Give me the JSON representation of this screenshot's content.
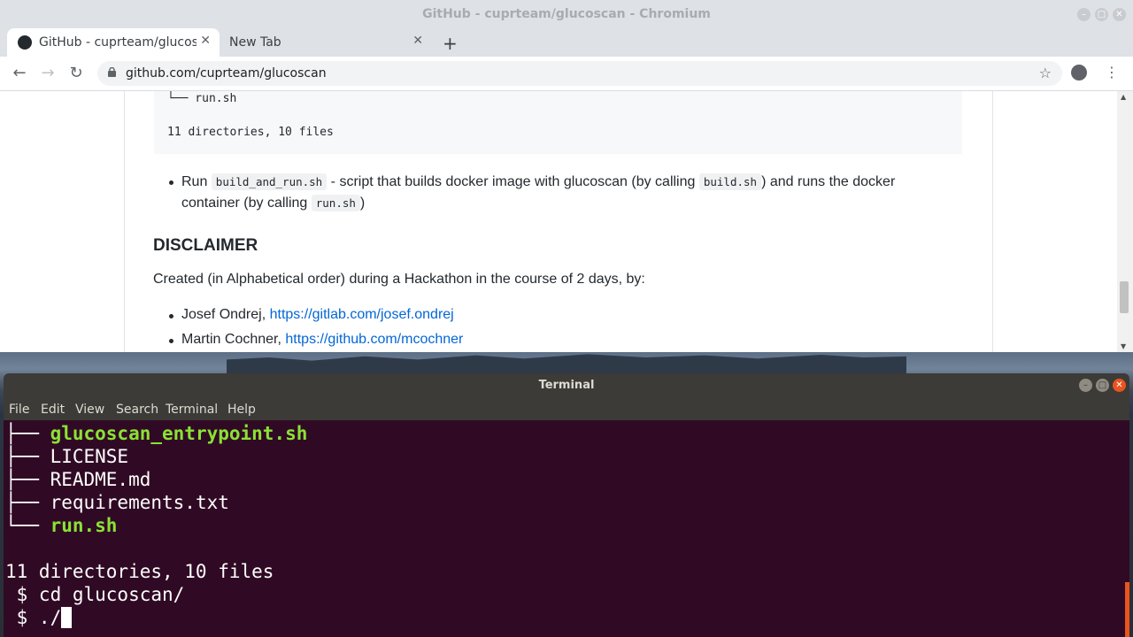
{
  "chromium": {
    "window_title": "GitHub - cuprteam/glucoscan - Chromium",
    "tabs": [
      {
        "label": "GitHub - cuprteam/glucoscan"
      },
      {
        "label": "New Tab"
      }
    ],
    "url": "github.com/cuprteam/glucoscan",
    "icons": [
      "back-icon",
      "forward-icon",
      "reload-icon",
      "lock-icon",
      "star-icon",
      "profile-icon",
      "menu-icon"
    ]
  },
  "readme": {
    "code_tail": "└── run.sh",
    "code_summary": "11 directories, 10 files",
    "run_bullet": {
      "pre": "Run ",
      "code1": "build_and_run.sh",
      "mid": " - script that builds docker image with glucoscan (by calling ",
      "code2": "build.sh",
      "mid2": ") and runs the docker container (by calling ",
      "code3": "run.sh",
      "post": ")"
    },
    "disclaimer_heading": "DISCLAIMER",
    "disclaimer_text": "Created (in Alphabetical order) during a Hackathon in the course of 2 days, by:",
    "authors": [
      {
        "name": "Josef Ondrej, ",
        "link": "https://gitlab.com/josef.ondrej"
      },
      {
        "name": "Martin Cochner, ",
        "link": "https://github.com/mcochner"
      }
    ]
  },
  "terminal": {
    "title": "Terminal",
    "menu": [
      "File",
      "Edit",
      "View",
      "Search",
      "Terminal",
      "Help"
    ],
    "lines": [
      {
        "prefix": "├── ",
        "text": "glucoscan_entrypoint.sh",
        "green": true
      },
      {
        "prefix": "├── ",
        "text": "LICENSE",
        "green": false
      },
      {
        "prefix": "├── ",
        "text": "README.md",
        "green": false
      },
      {
        "prefix": "├── ",
        "text": "requirements.txt",
        "green": false
      },
      {
        "prefix": "└── ",
        "text": "run.sh",
        "green": true
      }
    ],
    "summary": "11 directories, 10 files",
    "cmd1": " $ cd glucoscan/",
    "cmd2": " $ ./"
  },
  "colors": {
    "terminal_bg": "#300a24",
    "exec_green": "#8ae234",
    "link_blue": "#0366d6",
    "ubuntu_orange": "#e95420"
  }
}
